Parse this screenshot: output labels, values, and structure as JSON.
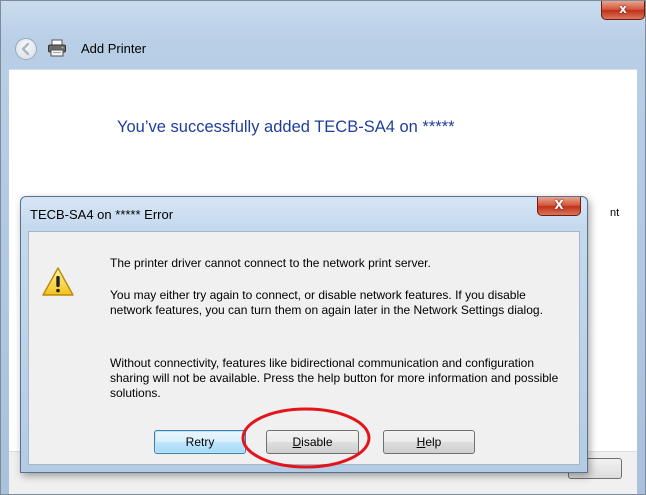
{
  "window": {
    "title": "Add Printer",
    "close_label": "x"
  },
  "wizard": {
    "heading": "You’ve successfully added TECB-SA4 on  *****",
    "clipped_fragment": "nt"
  },
  "dialog": {
    "title": "TECB-SA4 on ***** Error",
    "close_label": "X",
    "message_1": "The printer driver cannot connect to the network print server.",
    "message_2": "You may either try again to connect, or disable network features.  If you disable network features, you can turn them on again later in the Network Settings dialog.",
    "message_3": "Without connectivity, features like bidirectional communication and configuration sharing will not be available.  Press the help button for more information and possible solutions.",
    "buttons": {
      "retry": "Retry",
      "disable_accel": "D",
      "disable_rest": "isable",
      "help_accel": "H",
      "help_rest": "elp"
    }
  },
  "icons": {
    "back": "back-arrow-icon",
    "printer": "printer-icon",
    "warning": "warning-icon",
    "annotation": "red-ellipse-highlight"
  },
  "colors": {
    "heading": "#1e3e9b",
    "close": "#c03019",
    "annotation": "#e3141b",
    "default_button_border": "#3c7fb1"
  }
}
